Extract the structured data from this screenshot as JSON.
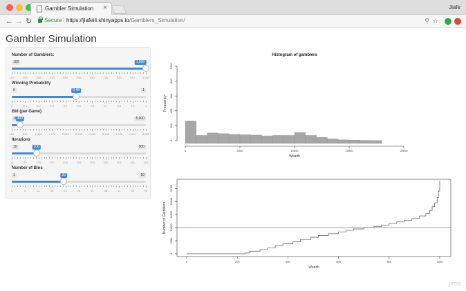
{
  "browser": {
    "tab_title": "Gambler Simulation",
    "tab_close": "×",
    "user": "Jiafe",
    "secure_label": "Secure",
    "url_host": "https://jiafeili.shinyapps.io",
    "url_path": "/Gamblers_Simulation/",
    "icons": [
      "back-icon",
      "forward-icon",
      "reload-icon",
      "lock-icon",
      "zoom-icon",
      "star-icon",
      "extension-icon"
    ]
  },
  "app": {
    "title": "Gambler Simulation"
  },
  "sliders": [
    {
      "label": "Number of Gamblers:",
      "min": 100,
      "max": 1000,
      "value": 1000,
      "min_label": "100",
      "max_label": "1,000",
      "value_label": "1,000",
      "ticks": [
        "100",
        "190",
        "280",
        "370",
        "460",
        "550",
        "640",
        "730",
        "820",
        "910",
        "1,000"
      ]
    },
    {
      "label": "Winning Probability",
      "min": 0,
      "max": 1,
      "value": 0.48,
      "min_label": "0",
      "max_label": "1",
      "value_label": "0.48",
      "ticks": [
        "0",
        "0.1",
        "0.2",
        "0.3",
        "0.4",
        "0.5",
        "0.6",
        "0.7",
        "0.8",
        "0.9",
        "1"
      ]
    },
    {
      "label": "Bid (per Game)",
      "min": 100,
      "max": 5000,
      "value": 400,
      "min_label": "100",
      "max_label": "5,000",
      "value_label": "400",
      "ticks": [
        "100",
        "590",
        "1,080",
        "1,570",
        "2,060",
        "2,550",
        "3,040",
        "3,530",
        "4,020",
        "4,510",
        "5,000"
      ]
    },
    {
      "label": "Iterations",
      "min": 10,
      "max": 500,
      "value": 100,
      "min_label": "10",
      "max_label": "500",
      "value_label": "100",
      "ticks": [
        "10",
        "59",
        "108",
        "157",
        "206",
        "255",
        "304",
        "353",
        "402",
        "451",
        "500"
      ]
    },
    {
      "label": "Number of Bins",
      "min": 1,
      "max": 50,
      "value": 20,
      "min_label": "1",
      "max_label": "50",
      "value_label": "20",
      "ticks": [
        "1",
        "6",
        "11",
        "16",
        "21",
        "26",
        "31",
        "36",
        "41",
        "46",
        "50"
      ]
    }
  ],
  "chart_data": [
    {
      "type": "bar",
      "title": "Histogram of gamblers",
      "xlabel": "Wealth",
      "ylabel": "Frequency",
      "xlim": [
        0,
        20000
      ],
      "ylim": [
        0,
        1000
      ],
      "xticks": [
        0,
        5000,
        10000,
        15000,
        20000
      ],
      "yticks": [
        0,
        200,
        400,
        600,
        800,
        1000
      ],
      "bin_width": 1000,
      "bins_start": [
        0,
        1000,
        2000,
        3000,
        4000,
        5000,
        6000,
        7000,
        8000,
        9000,
        10000,
        11000,
        12000,
        13000,
        14000,
        15000,
        16000,
        17000
      ],
      "values": [
        265,
        70,
        105,
        95,
        85,
        80,
        75,
        65,
        70,
        70,
        110,
        70,
        45,
        25,
        12,
        8,
        4,
        2
      ],
      "bar_color": "#a6a6a6",
      "grid": false
    },
    {
      "type": "line",
      "title": "",
      "xlabel": "Wealth",
      "ylabel": "Number of Gamblers",
      "xlim": [
        0,
        1000
      ],
      "ylim": [
        0,
        28000
      ],
      "xticks": [
        0,
        200,
        400,
        600,
        800,
        1000
      ],
      "yticks": [
        0,
        5000,
        10000,
        15000,
        20000,
        25000
      ],
      "series": [
        {
          "step": true,
          "x": [
            0,
            130,
            230,
            250,
            290,
            320,
            350,
            380,
            420,
            450,
            490,
            520,
            560,
            600,
            630,
            660,
            700,
            740,
            770,
            800,
            830,
            860,
            890,
            920,
            945,
            960,
            970,
            980,
            990,
            995,
            1000
          ],
          "y": [
            0,
            0,
            300,
            1000,
            1600,
            2300,
            3100,
            3800,
            4600,
            5500,
            6300,
            7000,
            7700,
            8400,
            9000,
            9500,
            10000,
            10500,
            11000,
            11600,
            12200,
            12800,
            13500,
            14500,
            15500,
            16500,
            18000,
            19500,
            21500,
            24000,
            28000
          ],
          "color": "#555555"
        }
      ],
      "hline": {
        "y": 10000,
        "color": "#d9534f"
      },
      "grid": false
    }
  ],
  "watermark": "jimo"
}
